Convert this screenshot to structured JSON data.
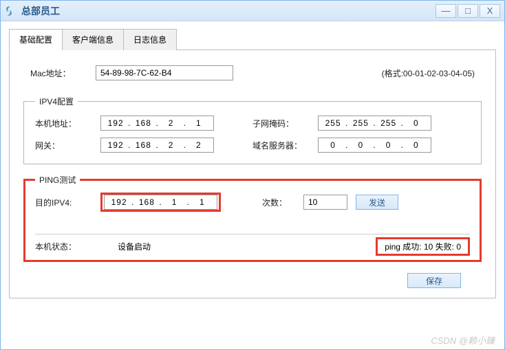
{
  "window": {
    "title": "总部员工"
  },
  "tabs": {
    "basic": "基础配置",
    "client": "客户端信息",
    "log": "日志信息"
  },
  "mac": {
    "label": "Mac地址：",
    "value": "54-89-98-7C-62-B4",
    "hint": "(格式:00-01-02-03-04-05)"
  },
  "ipv4": {
    "legend": "IPV4配置",
    "local_label": "本机地址：",
    "local": {
      "a": "192",
      "b": "168",
      "c": "2",
      "d": "1"
    },
    "mask_label": "子网掩码：",
    "mask": {
      "a": "255",
      "b": "255",
      "c": "255",
      "d": "0"
    },
    "gateway_label": "网关：",
    "gateway": {
      "a": "192",
      "b": "168",
      "c": "2",
      "d": "2"
    },
    "dns_label": "域名服务器：",
    "dns": {
      "a": "0",
      "b": "0",
      "c": "0",
      "d": "0"
    }
  },
  "ping": {
    "legend": "PING测试",
    "target_label": "目的IPV4:",
    "target": {
      "a": "192",
      "b": "168",
      "c": "1",
      "d": "1"
    },
    "count_label": "次数：",
    "count": "10",
    "send": "发送"
  },
  "status": {
    "label": "本机状态：",
    "value": "设备启动",
    "ping_result": "ping 成功: 10   失败: 0"
  },
  "save": "保存",
  "watermark": "CSDN @赖小臻"
}
